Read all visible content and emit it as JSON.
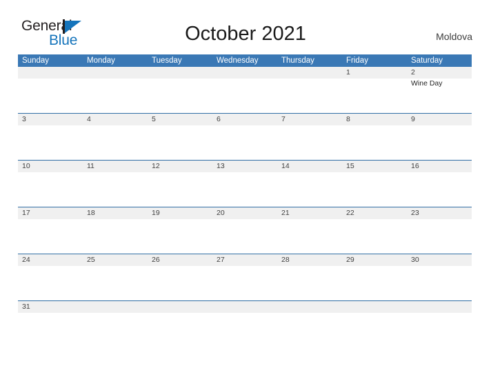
{
  "logo": {
    "word_one": "General",
    "word_two": "Blue",
    "flag_icon": "blue-triangle-flag-icon",
    "dark_color": "#231f20",
    "blue_color": "#1574bb"
  },
  "header": {
    "title": "October 2021",
    "region": "Moldova"
  },
  "colors": {
    "header_blue": "#3a78b5",
    "week_border_blue": "#2f6da4",
    "daynum_band": "#f0f0f0",
    "page_background": "#ffffff"
  },
  "calendar": {
    "month": "October",
    "year": "2021",
    "weekday_headers": [
      "Sunday",
      "Monday",
      "Tuesday",
      "Wednesday",
      "Thursday",
      "Friday",
      "Saturday"
    ],
    "weeks": [
      [
        {
          "day": "",
          "events": []
        },
        {
          "day": "",
          "events": []
        },
        {
          "day": "",
          "events": []
        },
        {
          "day": "",
          "events": []
        },
        {
          "day": "",
          "events": []
        },
        {
          "day": "1",
          "events": []
        },
        {
          "day": "2",
          "events": [
            "Wine Day"
          ]
        }
      ],
      [
        {
          "day": "3",
          "events": []
        },
        {
          "day": "4",
          "events": []
        },
        {
          "day": "5",
          "events": []
        },
        {
          "day": "6",
          "events": []
        },
        {
          "day": "7",
          "events": []
        },
        {
          "day": "8",
          "events": []
        },
        {
          "day": "9",
          "events": []
        }
      ],
      [
        {
          "day": "10",
          "events": []
        },
        {
          "day": "11",
          "events": []
        },
        {
          "day": "12",
          "events": []
        },
        {
          "day": "13",
          "events": []
        },
        {
          "day": "14",
          "events": []
        },
        {
          "day": "15",
          "events": []
        },
        {
          "day": "16",
          "events": []
        }
      ],
      [
        {
          "day": "17",
          "events": []
        },
        {
          "day": "18",
          "events": []
        },
        {
          "day": "19",
          "events": []
        },
        {
          "day": "20",
          "events": []
        },
        {
          "day": "21",
          "events": []
        },
        {
          "day": "22",
          "events": []
        },
        {
          "day": "23",
          "events": []
        }
      ],
      [
        {
          "day": "24",
          "events": []
        },
        {
          "day": "25",
          "events": []
        },
        {
          "day": "26",
          "events": []
        },
        {
          "day": "27",
          "events": []
        },
        {
          "day": "28",
          "events": []
        },
        {
          "day": "29",
          "events": []
        },
        {
          "day": "30",
          "events": []
        }
      ],
      [
        {
          "day": "31",
          "events": []
        },
        {
          "day": "",
          "events": []
        },
        {
          "day": "",
          "events": []
        },
        {
          "day": "",
          "events": []
        },
        {
          "day": "",
          "events": []
        },
        {
          "day": "",
          "events": []
        },
        {
          "day": "",
          "events": []
        }
      ]
    ]
  }
}
